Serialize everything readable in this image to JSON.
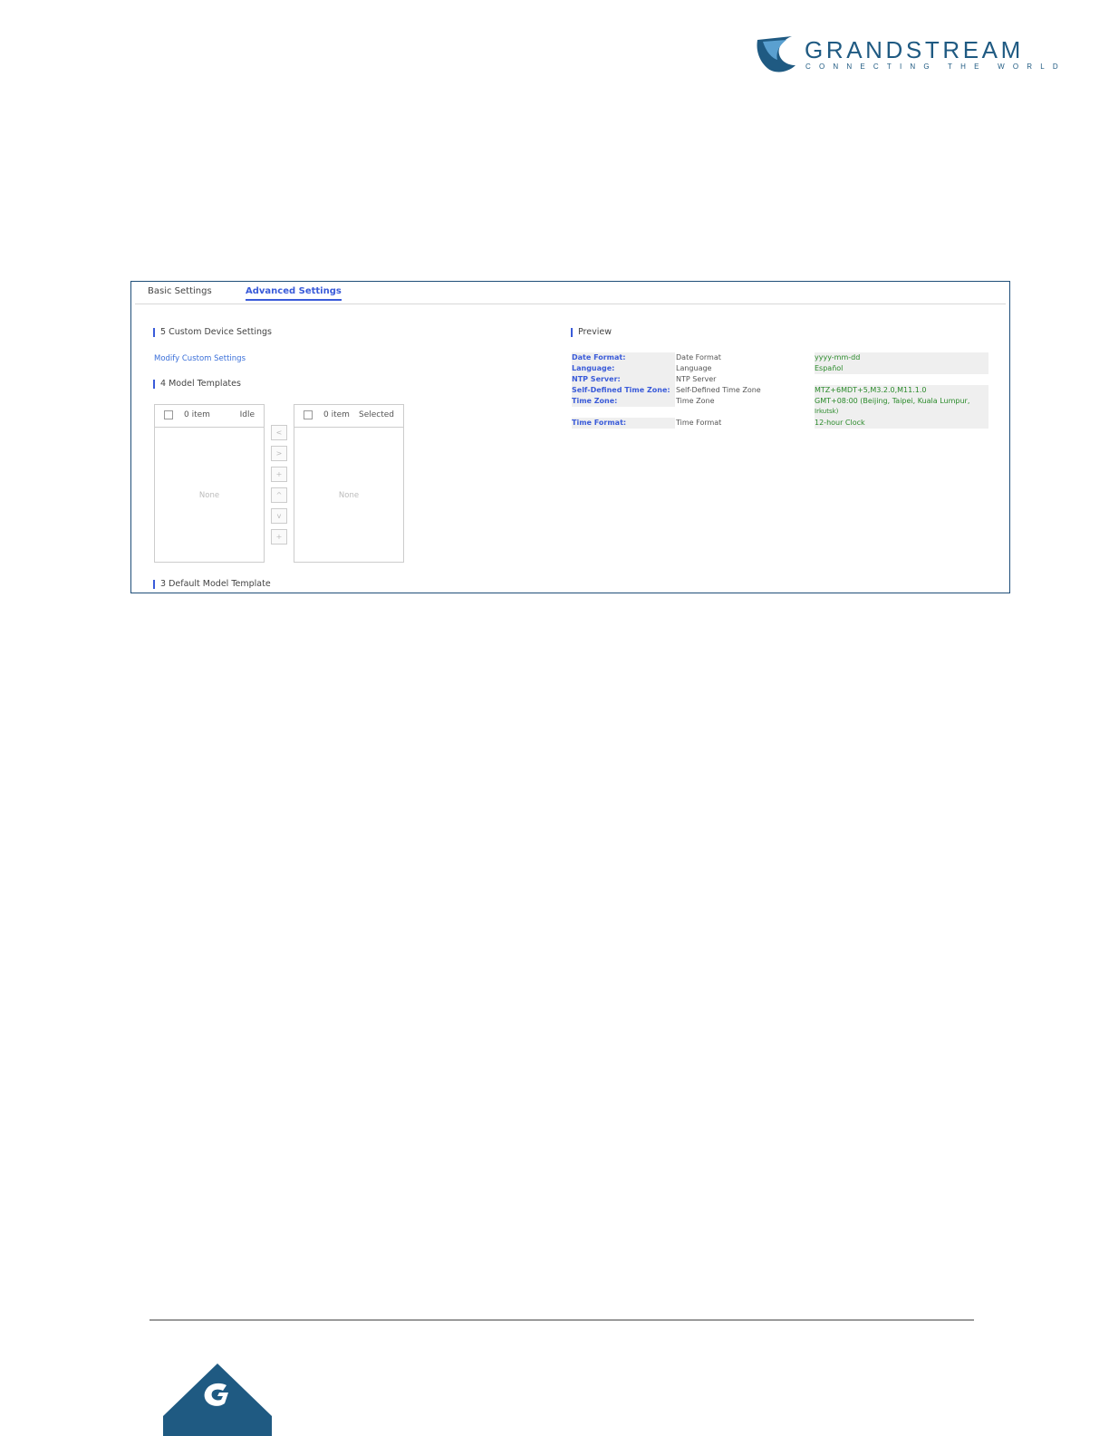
{
  "brand": {
    "name": "GRANDSTREAM",
    "tagline": "CONNECTING THE WORLD",
    "color": "#1f5a82"
  },
  "tabs": [
    {
      "label": "Basic Settings",
      "active": false
    },
    {
      "label": "Advanced Settings",
      "active": true
    }
  ],
  "custom_device": {
    "title": "5 Custom Device Settings",
    "link": "Modify Custom Settings"
  },
  "model_templates": {
    "title": "4 Model Templates",
    "idle": {
      "count": "0 item",
      "label": "Idle",
      "empty": "None"
    },
    "selected": {
      "count": "0 item",
      "label": "Selected",
      "empty": "None"
    },
    "buttons": [
      "<",
      ">",
      "+",
      "^",
      "v",
      "+"
    ]
  },
  "default_model": {
    "title": "3 Default Model Template"
  },
  "preview": {
    "title": "Preview",
    "rows": [
      {
        "key": "Date Format:",
        "name": "Date Format",
        "value": "yyyy-mm-dd"
      },
      {
        "key": "Language:",
        "name": "Language",
        "value": "Español"
      },
      {
        "key": "NTP Server:",
        "name": "NTP Server",
        "value": ""
      },
      {
        "key": "Self-Defined Time Zone:",
        "name": "Self-Defined Time Zone",
        "value": "MTZ+6MDT+5,M3.2.0,M11.1.0"
      },
      {
        "key": "Time Zone:",
        "name": "Time Zone",
        "value": "GMT+08:00 (Beijing, Taipei, Kuala Lumpur,"
      },
      {
        "key": "",
        "name": "",
        "value": "Irkutsk)"
      },
      {
        "key": "Time Format:",
        "name": "Time Format",
        "value": "12-hour Clock"
      }
    ]
  },
  "colors": {
    "accent": "#3a5bd9",
    "frame": "#1f4e79",
    "value_green": "#2a8a2a"
  }
}
